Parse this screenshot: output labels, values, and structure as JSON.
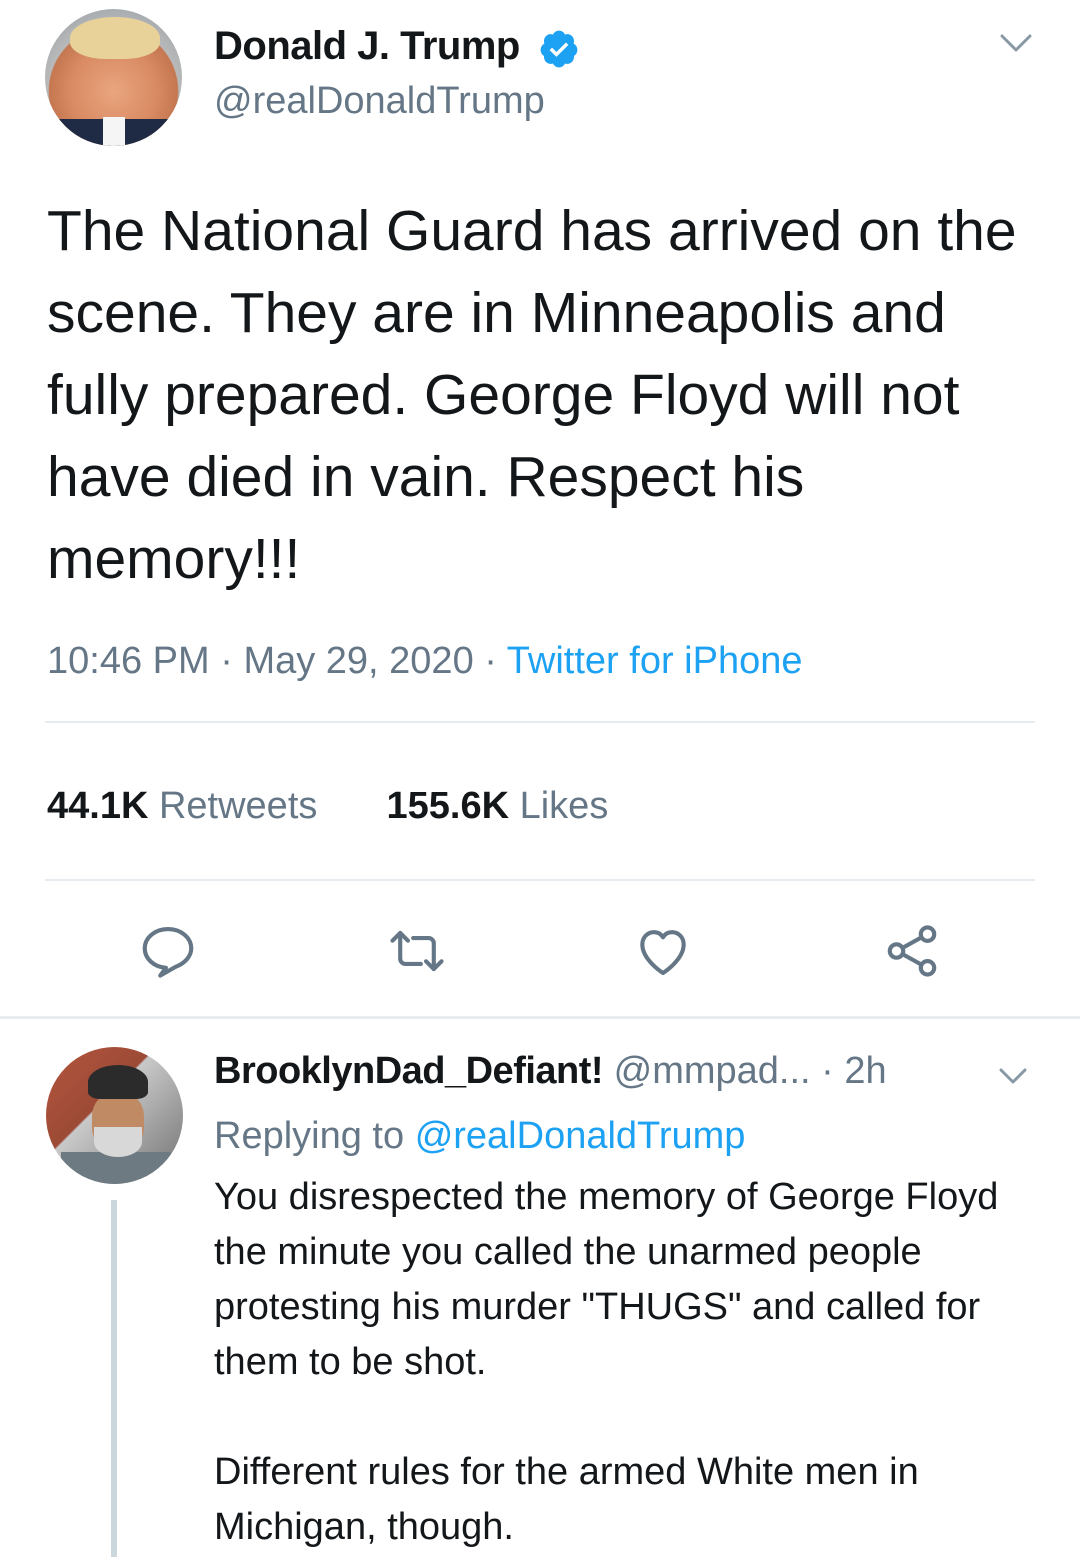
{
  "tweet": {
    "author": {
      "display_name": "Donald J. Trump",
      "handle": "@realDonaldTrump",
      "verified": true
    },
    "text": "The National Guard has arrived on the scene. They are in Minneapolis and fully prepared. George Floyd will not have died in vain. Respect his memory!!!",
    "time": "10:46 PM",
    "date": "May 29, 2020",
    "source": "Twitter for iPhone",
    "retweets_count": "44.1K",
    "retweets_label": "Retweets",
    "likes_count": "155.6K",
    "likes_label": "Likes",
    "separator": "·"
  },
  "actions": [
    "reply-icon",
    "retweet-icon",
    "like-icon",
    "share-icon"
  ],
  "reply": {
    "display_name": "BrooklynDad_Defiant!",
    "handle": "@mmpad...",
    "age": "2h",
    "separator": "·",
    "replying_prefix": "Replying to",
    "replying_to": "@realDonaldTrump",
    "paragraph1": "You disrespected the memory of George Floyd the minute you called the unarmed people protesting his murder \"THUGS\" and called for them to be shot.",
    "paragraph2": "Different rules for the armed White men in Michigan, though."
  },
  "colors": {
    "text": "#14171a",
    "secondary": "#657786",
    "accent": "#1da1f2",
    "divider": "#e6ecf0",
    "thread_line": "#ccd6dd"
  }
}
